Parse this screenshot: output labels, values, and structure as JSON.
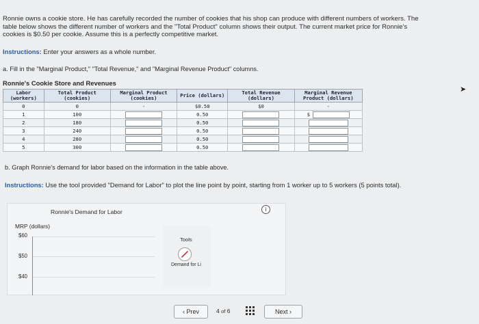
{
  "intro_text": "Ronnie owns a cookie store. He has carefully recorded the number of cookies that his shop can produce with different numbers of workers. The table below shows the different number of workers and the \"Total Product\" column shows their output. The current market price for Ronnie's cookies is $0.50 per cookie. Assume this is a perfectly competitive market.",
  "instructions_a": {
    "label": "Instructions:",
    "text": "Enter your answers as a whole number."
  },
  "part_a": "a. Fill in the \"Marginal Product,\" \"Total Revenue,\" and \"Marginal Revenue Product\" columns.",
  "table": {
    "title": "Ronnie's Cookie Store and Revenues",
    "headers": [
      "Labor (workers)",
      "Total Product (cookies)",
      "Marginal Product (cookies)",
      "Price (dollars)",
      "Total Revenue (dollars)",
      "Marginal Revenue Product (dollars)"
    ],
    "rows": [
      {
        "labor": "0",
        "tp": "0",
        "mp": "-",
        "price": "$0.50",
        "tr": "$0",
        "mrp": "-"
      },
      {
        "labor": "1",
        "tp": "100",
        "price": "0.50",
        "mrp_prefix": "$"
      },
      {
        "labor": "2",
        "tp": "180",
        "price": "0.50"
      },
      {
        "labor": "3",
        "tp": "240",
        "price": "0.50"
      },
      {
        "labor": "4",
        "tp": "280",
        "price": "0.50"
      },
      {
        "labor": "5",
        "tp": "300",
        "price": "0.50"
      }
    ]
  },
  "part_b": "b. Graph Ronnie's demand for labor based on the information in the table above.",
  "instructions_b": {
    "label": "Instructions:",
    "text": "Use the tool provided \"Demand for Labor\" to plot the line point by point, starting from 1 worker up to 5 workers (5 points total)."
  },
  "graph": {
    "title": "Ronnie's Demand for Labor",
    "ylabel": "MRP (dollars)",
    "ticks": [
      "$60",
      "$50",
      "$40"
    ],
    "info_icon": "i",
    "tools_title": "Tools",
    "tool_label": "Demand for Li",
    "tool_icon": "pencil-icon"
  },
  "nav": {
    "prev": "Prev",
    "page_current": "4",
    "page_of": "of",
    "page_total": "6",
    "next": "Next"
  }
}
